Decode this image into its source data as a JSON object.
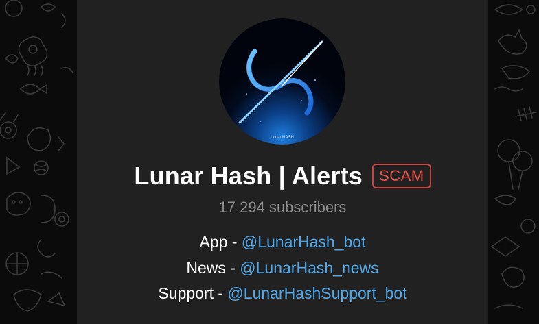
{
  "channel": {
    "name": "Lunar Hash | Alerts",
    "badge": "SCAM",
    "subscribers": "17 294 subscribers",
    "logo_caption": "Lunar HASH",
    "links": [
      {
        "label": "App - ",
        "handle": "@LunarHash_bot"
      },
      {
        "label": "News - ",
        "handle": "@LunarHash_news"
      },
      {
        "label": "Support - ",
        "handle": "@LunarHashSupport_bot"
      }
    ]
  },
  "colors": {
    "panel": "#212121",
    "background": "#0b0b0b",
    "link": "#4fa8ea",
    "scam_badge": "#e5534b",
    "subtitle": "#8d8d8d"
  },
  "background_pattern": "doodle-pattern"
}
